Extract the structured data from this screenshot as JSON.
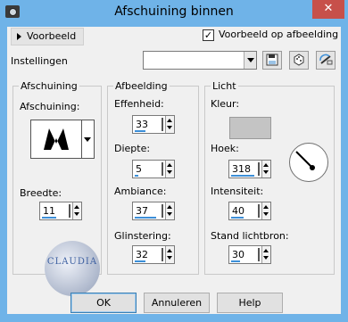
{
  "window": {
    "title": "Afschuining binnen",
    "close_glyph": "✕",
    "icon": "camera-app-icon"
  },
  "toolbar": {
    "preview_label": "Voorbeeld",
    "preview_on_image_label": "Voorbeeld op afbeelding",
    "preview_on_image_checked": true,
    "settings_label": "Instellingen",
    "settings_value": "",
    "save_icon": "save-icon",
    "dice_icon": "randomize-icon",
    "reset_icon": "reset-icon"
  },
  "bevel": {
    "group_title": "Afschuining",
    "shape_label": "Afschuining:",
    "width_label": "Breedte:",
    "width_value": "11"
  },
  "image": {
    "group_title": "Afbeelding",
    "smoothness_label": "Effenheid:",
    "smoothness_value": "33",
    "depth_label": "Diepte:",
    "depth_value": "5",
    "ambience_label": "Ambiance:",
    "ambience_value": "37",
    "shininess_label": "Glinstering:",
    "shininess_value": "32"
  },
  "light": {
    "group_title": "Licht",
    "color_label": "Kleur:",
    "color_value": "#c4c4c4",
    "angle_label": "Hoek:",
    "angle_value": "318",
    "intensity_label": "Intensiteit:",
    "intensity_value": "40",
    "elevation_label": "Stand lichtbron:",
    "elevation_value": "30"
  },
  "watermark": {
    "text": "CLAUDIA"
  },
  "buttons": {
    "ok": "OK",
    "cancel": "Annuleren",
    "help": "Help"
  },
  "colors": {
    "accent": "#3c8fd8",
    "titlebar": "#6fb3e8",
    "close": "#c7504a"
  }
}
